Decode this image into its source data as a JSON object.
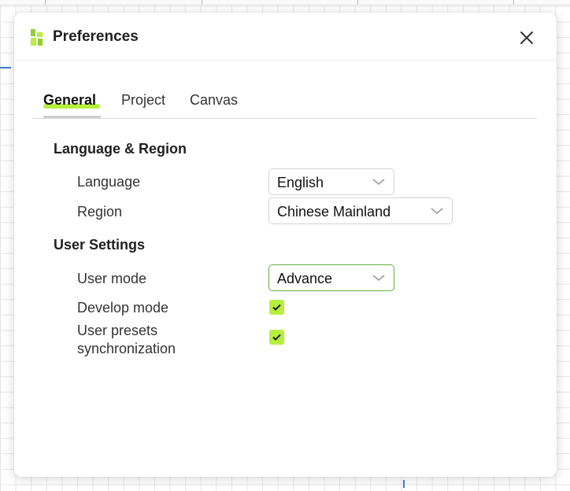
{
  "dialog": {
    "title": "Preferences",
    "close_icon": "close-icon",
    "logo_icon": "app-logo-icon",
    "accent_color": "#b6ef3e"
  },
  "tabs": [
    {
      "label": "General",
      "active": true
    },
    {
      "label": "Project",
      "active": false
    },
    {
      "label": "Canvas",
      "active": false
    }
  ],
  "sections": {
    "language_region": {
      "title": "Language & Region",
      "language": {
        "label": "Language",
        "value": "English"
      },
      "region": {
        "label": "Region",
        "value": "Chinese Mainland"
      }
    },
    "user_settings": {
      "title": "User Settings",
      "user_mode": {
        "label": "User mode",
        "value": "Advance"
      },
      "develop_mode": {
        "label": "Develop mode",
        "checked": true
      },
      "user_presets_sync": {
        "label_line1": "User presets",
        "label_line2": "synchronization",
        "checked": true
      }
    }
  }
}
